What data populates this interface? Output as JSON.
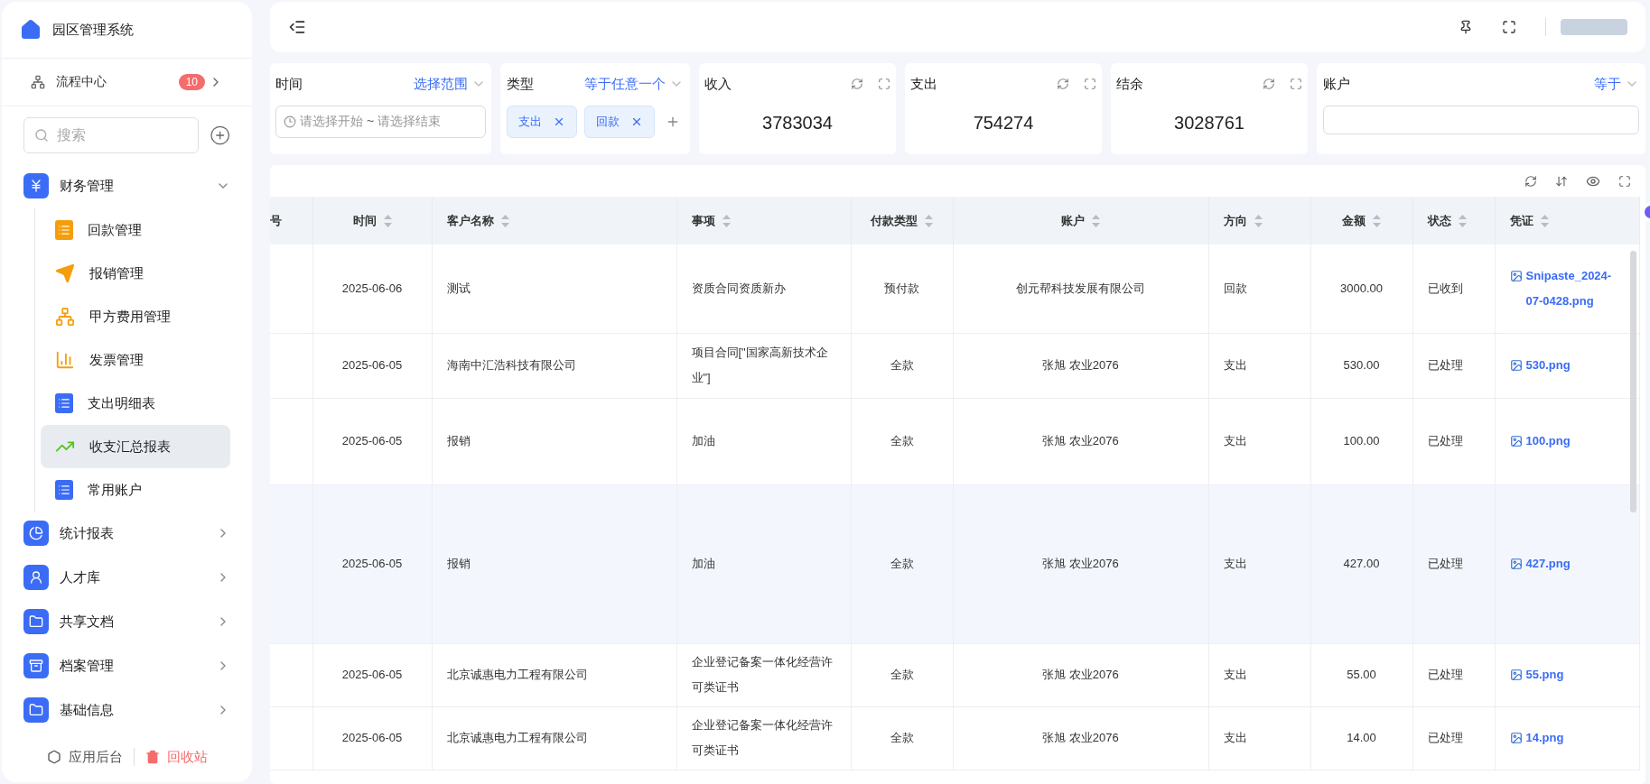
{
  "sidebar": {
    "title": "园区管理系统",
    "workflow": {
      "label": "流程中心",
      "badge": "10"
    },
    "search": {
      "placeholder": "搜索"
    },
    "menu": [
      {
        "label": "财务管理",
        "expanded": true,
        "children": [
          {
            "label": "回款管理",
            "selected": false
          },
          {
            "label": "报销管理",
            "selected": false
          },
          {
            "label": "甲方费用管理",
            "selected": false
          },
          {
            "label": "发票管理",
            "selected": false
          },
          {
            "label": "支出明细表",
            "selected": false
          },
          {
            "label": "收支汇总报表",
            "selected": true
          },
          {
            "label": "常用账户",
            "selected": false
          }
        ]
      },
      {
        "label": "统计报表",
        "expanded": false
      },
      {
        "label": "人才库",
        "expanded": false
      },
      {
        "label": "共享文档",
        "expanded": false
      },
      {
        "label": "档案管理",
        "expanded": false
      },
      {
        "label": "基础信息",
        "expanded": false
      }
    ],
    "footer": [
      {
        "label": "应用后台",
        "kind": "settings"
      },
      {
        "label": "回收站",
        "kind": "trash"
      }
    ]
  },
  "filters": {
    "time": {
      "label": "时间",
      "mode": "选择范围",
      "start_placeholder": "请选择开始",
      "separator": "~",
      "end_placeholder": "请选择结束"
    },
    "type": {
      "label": "类型",
      "mode": "等于任意一个",
      "tags": [
        "支出",
        "回款"
      ]
    },
    "stats": [
      {
        "label": "收入",
        "value": "3783034"
      },
      {
        "label": "支出",
        "value": "754274"
      },
      {
        "label": "结余",
        "value": "3028761"
      }
    ],
    "account": {
      "label": "账户",
      "mode": "等于"
    }
  },
  "table": {
    "columns": [
      "号",
      "时间",
      "客户名称",
      "事项",
      "付款类型",
      "账户",
      "方向",
      "金额",
      "状态",
      "凭证"
    ],
    "rows": [
      {
        "selected": false,
        "cells": [
          "",
          "2025-06-06",
          "测试",
          "资质合同资质新办",
          "预付款",
          "创元帮科技发展有限公司",
          "回款",
          "3000.00",
          "已收到",
          "Snipaste_2024-07-0428.png"
        ]
      },
      {
        "selected": false,
        "cells": [
          "",
          "2025-06-05",
          "海南中汇浩科技有限公司",
          "项目合同[\"国家高新技术企业\"]",
          "全款",
          "张旭 农业2076",
          "支出",
          "530.00",
          "已处理",
          "530.png"
        ]
      },
      {
        "selected": false,
        "cells": [
          "",
          "2025-06-05",
          "报销",
          "加油",
          "全款",
          "张旭 农业2076",
          "支出",
          "100.00",
          "已处理",
          "100.png"
        ]
      },
      {
        "selected": true,
        "cells": [
          "",
          "2025-06-05",
          "报销",
          "加油",
          "全款",
          "张旭 农业2076",
          "支出",
          "427.00",
          "已处理",
          "427.png"
        ]
      },
      {
        "selected": false,
        "cells": [
          "",
          "2025-06-05",
          "北京诚惠电力工程有限公司",
          "企业登记备案一体化经营许可类证书",
          "全款",
          "张旭 农业2076",
          "支出",
          "55.00",
          "已处理",
          "55.png"
        ]
      },
      {
        "selected": false,
        "cells": [
          "",
          "2025-06-05",
          "北京诚惠电力工程有限公司",
          "企业登记备案一体化经营许可类证书",
          "全款",
          "张旭 农业2076",
          "支出",
          "14.00",
          "已处理",
          "14.png"
        ]
      }
    ]
  }
}
